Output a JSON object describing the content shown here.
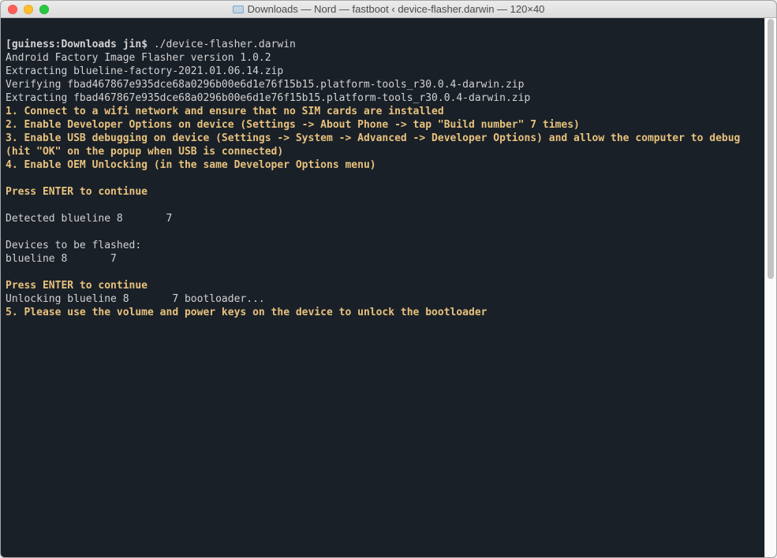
{
  "window": {
    "title": "Downloads — Nord — fastboot ‹ device-flasher.darwin — 120×40"
  },
  "terminal": {
    "prompt_host": "guiness:Downloads jin$ ",
    "prompt_cmd": "./device-flasher.darwin",
    "lines_plain_1": "Android Factory Image Flasher version 1.0.2",
    "lines_plain_2": "Extracting blueline-factory-2021.01.06.14.zip",
    "lines_plain_3": "Verifying fbad467867e935dce68a0296b00e6d1e76f15b15.platform-tools_r30.0.4-darwin.zip",
    "lines_plain_4": "Extracting fbad467867e935dce68a0296b00e6d1e76f15b15.platform-tools_r30.0.4-darwin.zip",
    "step1": "1. Connect to a wifi network and ensure that no SIM cards are installed",
    "step2": "2. Enable Developer Options on device (Settings -> About Phone -> tap \"Build number\" 7 times)",
    "step3": "3. Enable USB debugging on device (Settings -> System -> Advanced -> Developer Options) and allow the computer to debug",
    "step3b": "(hit \"OK\" on the popup when USB is connected)",
    "step4": "4. Enable OEM Unlocking (in the same Developer Options menu)",
    "press1": "Press ENTER to continue",
    "detect": "Detected blueline 8       7",
    "devices_hdr": "Devices to be flashed:",
    "devices_row": "blueline 8       7",
    "press2": "Press ENTER to continue",
    "unlock": "Unlocking blueline 8       7 bootloader...",
    "step5": "5. Please use the volume and power keys on the device to unlock the bootloader"
  }
}
